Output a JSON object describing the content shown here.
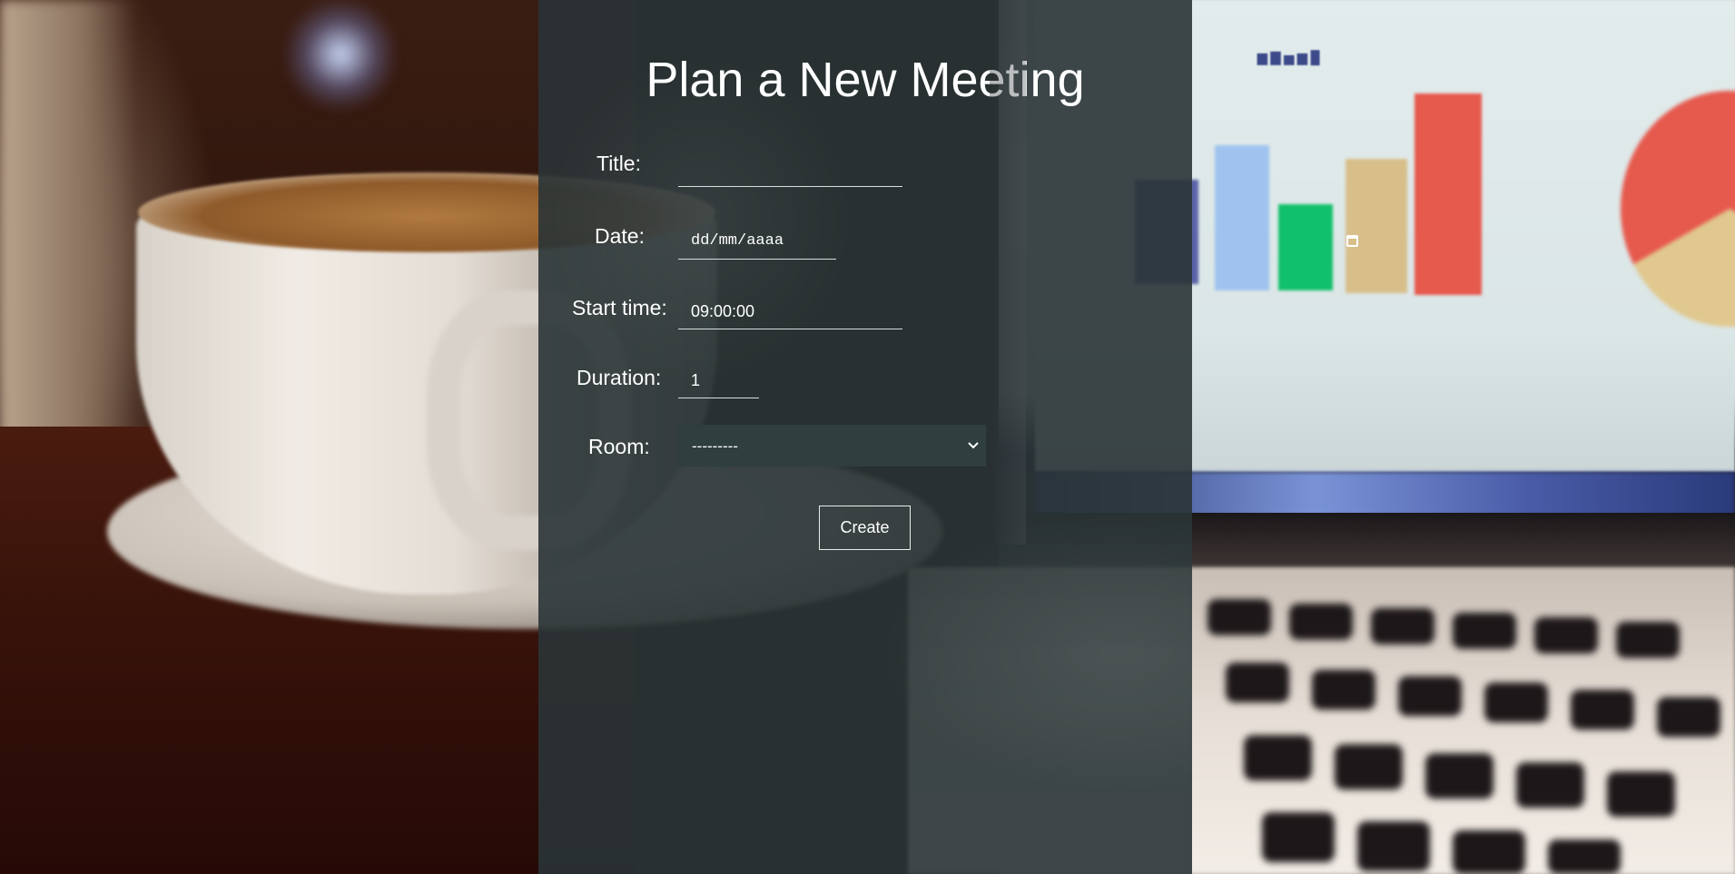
{
  "page": {
    "title": "Plan a New Meeting"
  },
  "form": {
    "title": {
      "label": "Title:",
      "value": ""
    },
    "date": {
      "label": "Date:",
      "placeholder": "dd/mm/aaaa"
    },
    "start_time": {
      "label": "Start time:",
      "value": "09:00:00"
    },
    "duration": {
      "label": "Duration:",
      "value": "1"
    },
    "room": {
      "label": "Room:",
      "selected": "---------"
    },
    "submit_label": "Create"
  },
  "icons": {
    "date_picker": "calendar-icon",
    "select_arrow": "chevron-down-icon"
  },
  "colors": {
    "panel_overlay": "#2a3436",
    "select_background": "#2f3e3e",
    "text": "#ffffff",
    "underline": "#d8dedf"
  }
}
